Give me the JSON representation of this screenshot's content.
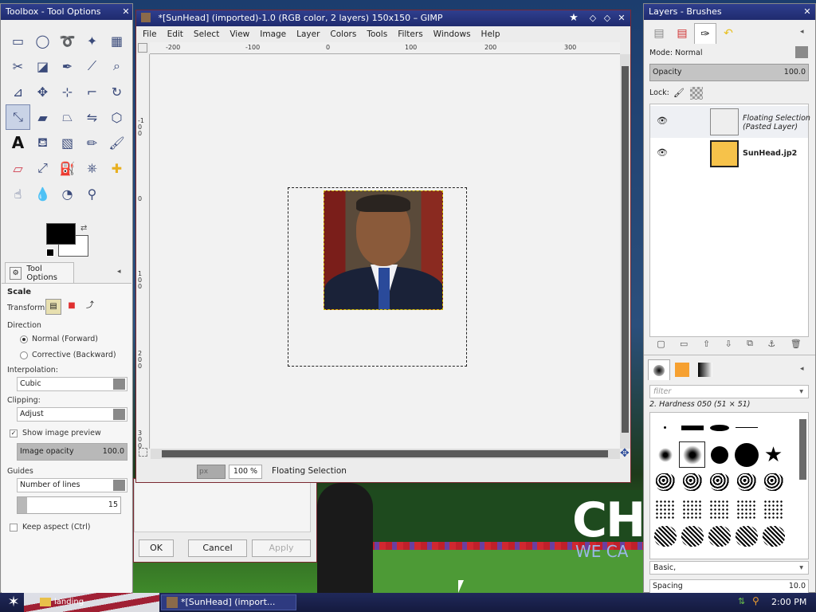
{
  "desktop": {
    "banner_text": "CHA",
    "banner_subtext": "WE CA"
  },
  "toolbox": {
    "title": "Toolbox - Tool Options",
    "tools": [
      "rect-select",
      "ellipse-select",
      "free-select",
      "fuzzy-select",
      "select-by-color",
      "scissors-select",
      "foreground-select",
      "paths",
      "color-picker",
      "zoom",
      "measure",
      "move",
      "align",
      "crop",
      "rotate",
      "scale",
      "shear",
      "perspective",
      "flip",
      "cage-transform",
      "text",
      "bucket-fill",
      "blend",
      "pencil",
      "paintbrush",
      "eraser",
      "airbrush",
      "ink",
      "clone",
      "heal",
      "smudge",
      "dodge-burn",
      "blur-sharpen",
      "convolve"
    ],
    "tool_options_tab": "Tool Options",
    "tool_name": "Scale",
    "transform_label": "Transform:",
    "direction_label": "Direction",
    "direction_options": [
      "Normal (Forward)",
      "Corrective (Backward)"
    ],
    "interpolation_label": "Interpolation:",
    "interpolation_value": "Cubic",
    "clipping_label": "Clipping:",
    "clipping_value": "Adjust",
    "show_preview_label": "Show image preview",
    "image_opacity_label": "Image opacity",
    "image_opacity_value": "100.0",
    "image_opacity_fraction": 1.0,
    "guides_label": "Guides",
    "guides_value": "Number of lines",
    "guides_count": "15",
    "keep_aspect_label": "Keep aspect  (Ctrl)"
  },
  "scale_dialog": {
    "ok_label": "OK",
    "cancel_label": "Cancel",
    "apply_label": "Apply"
  },
  "image_window": {
    "title": "*[SunHead] (imported)-1.0 (RGB color, 2 layers) 150x150 – GIMP",
    "menus": [
      "File",
      "Edit",
      "Select",
      "View",
      "Image",
      "Layer",
      "Colors",
      "Tools",
      "Filters",
      "Windows",
      "Help"
    ],
    "ruler_h_ticks": [
      "-200",
      "-100",
      "0",
      "100",
      "200",
      "300"
    ],
    "ruler_v_ticks": [
      "-100",
      "0",
      "100",
      "200",
      "300"
    ],
    "unit": "px",
    "zoom": "100 %",
    "status": "Floating Selection"
  },
  "layers_dock": {
    "title": "Layers - Brushes",
    "mode_label": "Mode: Normal",
    "opacity_label": "Opacity",
    "opacity_value": "100.0",
    "lock_label": "Lock:",
    "layers": [
      {
        "name": "Floating Selection\n(Pasted Layer)",
        "visible": true,
        "italic": true
      },
      {
        "name": "SunHead.jp2",
        "visible": true,
        "italic": false
      }
    ],
    "filter_placeholder": "filter",
    "brush_name": "2. Hardness 050 (51 × 51)",
    "preset_value": "Basic,",
    "spacing_label": "Spacing",
    "spacing_value": "10.0"
  },
  "taskbar": {
    "folder_label": "landing",
    "gimp_task_label": "*[SunHead] (import...",
    "clock": "2:00 PM"
  },
  "colors": {
    "titlebar": "#1f2b6e",
    "foreground": "#000000",
    "background": "#ffffff",
    "layer_thumb": "#f6c24a"
  }
}
